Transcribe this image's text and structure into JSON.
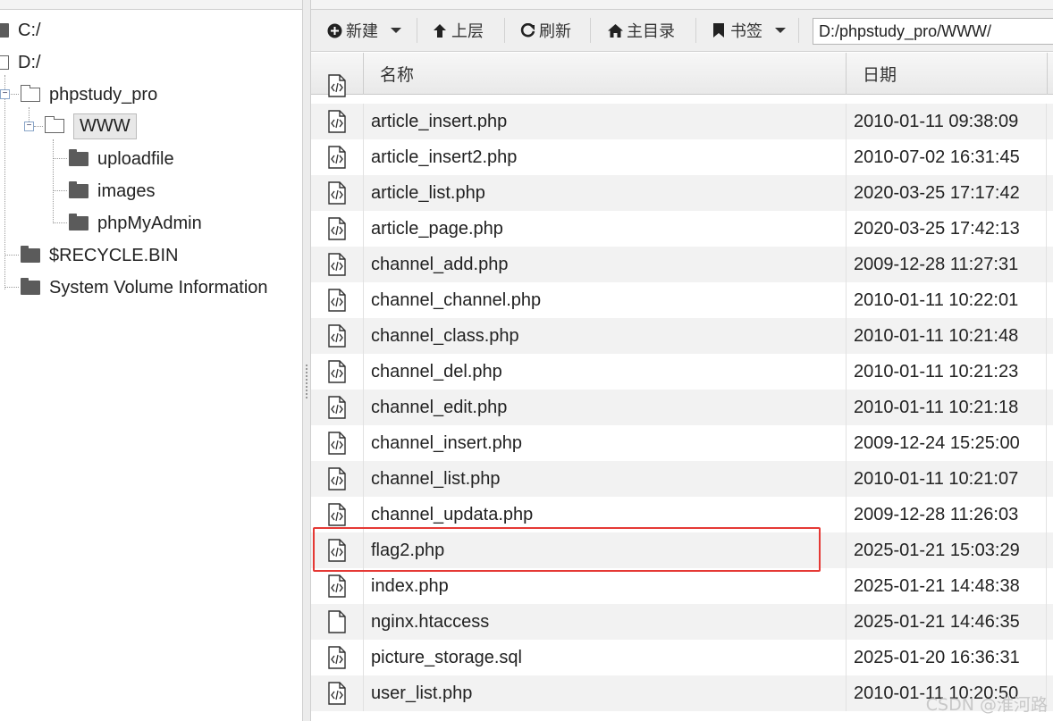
{
  "tree": {
    "nodes": [
      {
        "label": "C:/"
      },
      {
        "label": "D:/"
      },
      {
        "label": "phpstudy_pro"
      },
      {
        "label": "WWW"
      },
      {
        "label": "uploadfile"
      },
      {
        "label": "images"
      },
      {
        "label": "phpMyAdmin"
      },
      {
        "label": "$RECYCLE.BIN"
      },
      {
        "label": "System Volume Information"
      }
    ]
  },
  "toolbar": {
    "new_label": "新建",
    "up_label": "上层",
    "refresh_label": "刷新",
    "home_label": "主目录",
    "bookmarks_label": "书签",
    "path_value": "D:/phpstudy_pro/WWW/"
  },
  "table": {
    "col_name": "名称",
    "col_date": "日期",
    "rows": [
      {
        "name": "article_insert.php",
        "date": "2010-01-11 09:38:09",
        "icon": "code-file-icon"
      },
      {
        "name": "article_insert2.php",
        "date": "2010-07-02 16:31:45",
        "icon": "code-file-icon"
      },
      {
        "name": "article_list.php",
        "date": "2020-03-25 17:17:42",
        "icon": "code-file-icon"
      },
      {
        "name": "article_page.php",
        "date": "2020-03-25 17:42:13",
        "icon": "code-file-icon"
      },
      {
        "name": "channel_add.php",
        "date": "2009-12-28 11:27:31",
        "icon": "code-file-icon"
      },
      {
        "name": "channel_channel.php",
        "date": "2010-01-11 10:22:01",
        "icon": "code-file-icon"
      },
      {
        "name": "channel_class.php",
        "date": "2010-01-11 10:21:48",
        "icon": "code-file-icon"
      },
      {
        "name": "channel_del.php",
        "date": "2010-01-11 10:21:23",
        "icon": "code-file-icon"
      },
      {
        "name": "channel_edit.php",
        "date": "2010-01-11 10:21:18",
        "icon": "code-file-icon"
      },
      {
        "name": "channel_insert.php",
        "date": "2009-12-24 15:25:00",
        "icon": "code-file-icon"
      },
      {
        "name": "channel_list.php",
        "date": "2010-01-11 10:21:07",
        "icon": "code-file-icon"
      },
      {
        "name": "channel_updata.php",
        "date": "2009-12-28 11:26:03",
        "icon": "code-file-icon"
      },
      {
        "name": "flag2.php",
        "date": "2025-01-21 15:03:29",
        "icon": "code-file-icon"
      },
      {
        "name": "index.php",
        "date": "2025-01-21 14:48:38",
        "icon": "code-file-icon"
      },
      {
        "name": "nginx.htaccess",
        "date": "2025-01-21 14:46:35",
        "icon": "blank-file-icon"
      },
      {
        "name": "picture_storage.sql",
        "date": "2025-01-20 16:36:31",
        "icon": "code-file-icon"
      },
      {
        "name": "user_list.php",
        "date": "2010-01-11 10:20:50",
        "icon": "code-file-icon"
      }
    ]
  },
  "watermark": "CSDN @淮河路",
  "colors": {
    "highlight": "#e53935",
    "row_alt": "#f2f2f2"
  }
}
